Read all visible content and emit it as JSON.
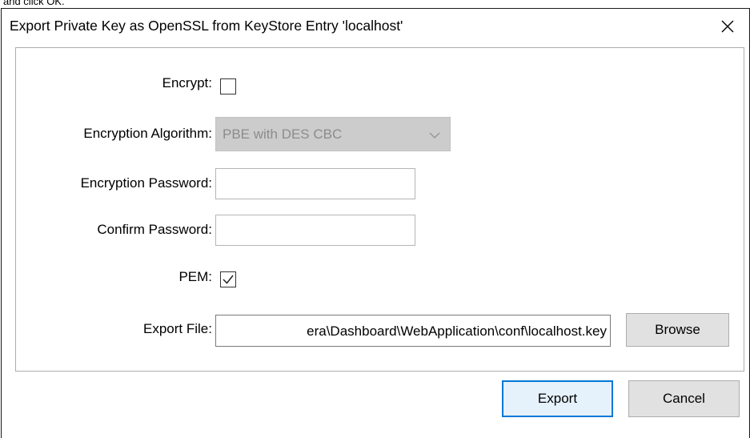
{
  "window": {
    "title": "Export Private Key as OpenSSL from KeyStore Entry 'localhost'",
    "close_icon": "close-icon",
    "above_text": "and click OK."
  },
  "form": {
    "encrypt": {
      "label": "Encrypt:",
      "checked": false
    },
    "algorithm": {
      "label": "Encryption Algorithm:",
      "value": "PBE with DES CBC",
      "enabled": false
    },
    "password": {
      "label": "Encryption Password:",
      "value": ""
    },
    "confirm": {
      "label": "Confirm Password:",
      "value": ""
    },
    "pem": {
      "label": "PEM:",
      "checked": true
    },
    "export_file": {
      "label": "Export File:",
      "value": "era\\Dashboard\\WebApplication\\conf\\localhost.key"
    }
  },
  "buttons": {
    "browse": "Browse",
    "export": "Export",
    "cancel": "Cancel"
  },
  "colors": {
    "accent": "#0078d7",
    "button_bg": "#e1e1e1",
    "disabled_bg": "#cccccc"
  }
}
